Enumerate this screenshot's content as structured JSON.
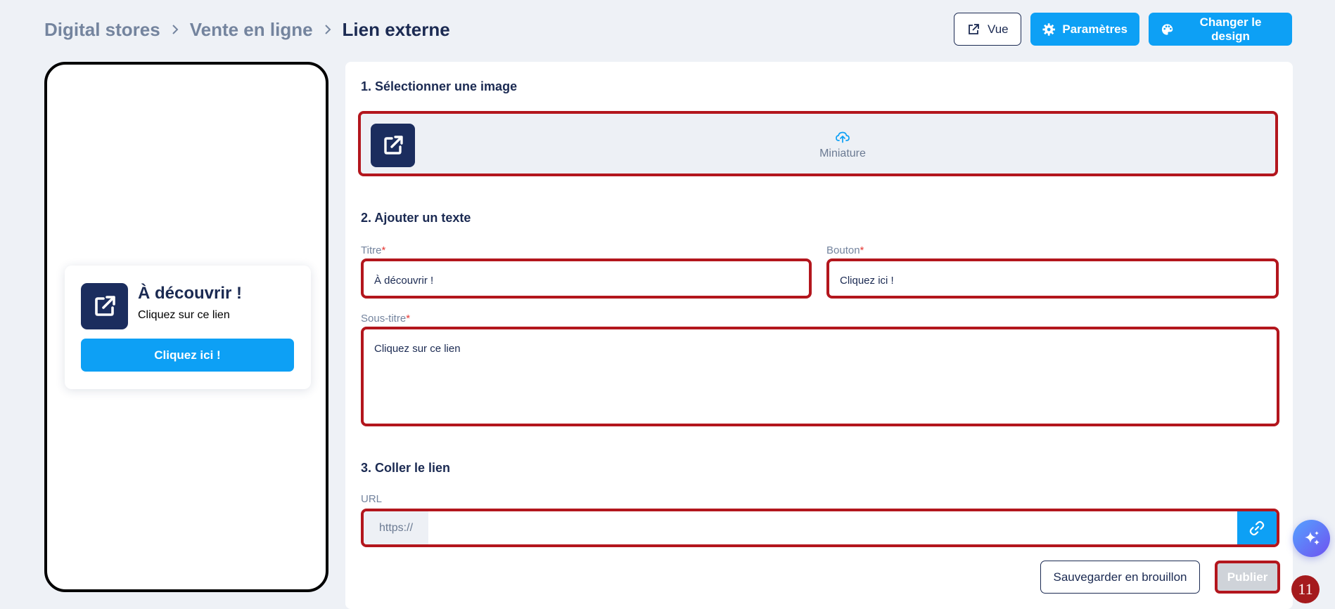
{
  "breadcrumb": {
    "items": [
      "Digital stores",
      "Vente en ligne"
    ],
    "current": "Lien externe"
  },
  "header": {
    "view_label": "Vue",
    "settings_label": "Paramètres",
    "design_label": "Changer le design"
  },
  "preview": {
    "title": "À découvrir !",
    "subtitle": "Cliquez sur ce lien",
    "button_label": "Cliquez ici !"
  },
  "form": {
    "section_image": "1. Sélectionner une image",
    "upload_label": "Miniature",
    "section_text": "2. Ajouter un texte",
    "title_label": "Titre",
    "title_value": "À découvrir !",
    "button_label": "Bouton",
    "button_value": "Cliquez ici !",
    "subtitle_label": "Sous-titre",
    "subtitle_value": "Cliquez sur ce lien",
    "required_mark": "*",
    "section_link": "3. Coller le lien",
    "url_label": "URL",
    "url_prefix": "https://",
    "url_value": ""
  },
  "actions": {
    "draft_label": "Sauvegarder en brouillon",
    "publish_label": "Publier"
  },
  "step_badge": "11",
  "colors": {
    "primary": "#0da0f5",
    "navy": "#1b2d5e",
    "highlight": "#b3161d",
    "background": "#eef1f6"
  },
  "icons": [
    "external-link-icon",
    "gear-icon",
    "palette-icon",
    "upload-cloud-icon",
    "link-icon",
    "sparkles-icon",
    "chevron-right-icon"
  ]
}
